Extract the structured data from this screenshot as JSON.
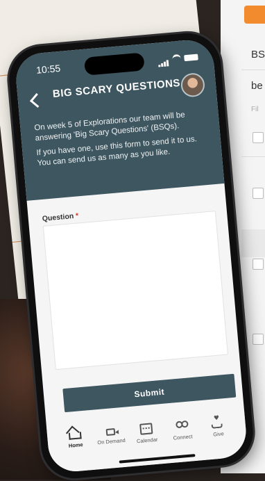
{
  "status": {
    "time": "10:55"
  },
  "header": {
    "title": "BIG SCARY QUESTIONS"
  },
  "intro": {
    "line1": "On week 5 of Explorations our team will be answering 'Big Scary Questions' (BSQs).",
    "line2": "If you have one, use this form to send it to us. You can send us as many as you like."
  },
  "form": {
    "question_label": "Question",
    "required_mark": "*",
    "question_value": "",
    "submit_label": "Submit"
  },
  "tabs": [
    {
      "label": "Home",
      "icon": "home-icon",
      "active": true
    },
    {
      "label": "On Demand",
      "icon": "video-icon"
    },
    {
      "label": "Calendar",
      "icon": "calendar-icon"
    },
    {
      "label": "Connect",
      "icon": "people-icon"
    },
    {
      "label": "Give",
      "icon": "give-icon"
    }
  ],
  "background_panel": {
    "text1": "BS",
    "text2": "be",
    "text3": "Fil"
  },
  "colors": {
    "header": "#3e5660",
    "accent": "#f28a2e",
    "required": "#d0342c"
  }
}
